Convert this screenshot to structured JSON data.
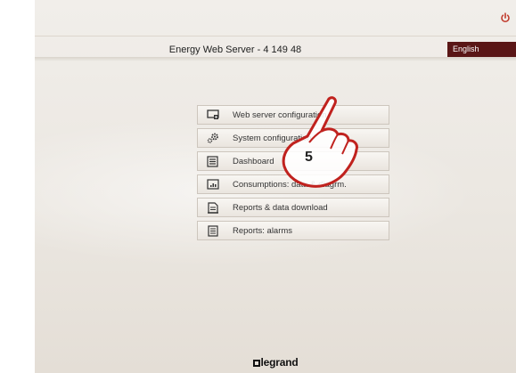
{
  "header": {
    "title": "Energy Web Server - 4 149 48",
    "language": "English",
    "power_icon": "power-icon"
  },
  "colors": {
    "accent": "#5a1616",
    "power": "#c0392b",
    "background": "#ebe7e1"
  },
  "menu": {
    "items": [
      {
        "label": "Web server configuration",
        "icon": "monitor-settings-icon"
      },
      {
        "label": "System configuration",
        "icon": "gears-icon"
      },
      {
        "label": "Dashboard",
        "icon": "dashboard-icon"
      },
      {
        "label": "Consumptions: data & diagrm.",
        "icon": "chart-icon"
      },
      {
        "label": "Reports & data download",
        "icon": "report-download-icon"
      },
      {
        "label": "Reports: alarms",
        "icon": "report-list-icon"
      }
    ]
  },
  "overlay": {
    "step_number": "5",
    "icon": "hand-pointer-icon"
  },
  "footer": {
    "logo_text": "legrand"
  }
}
